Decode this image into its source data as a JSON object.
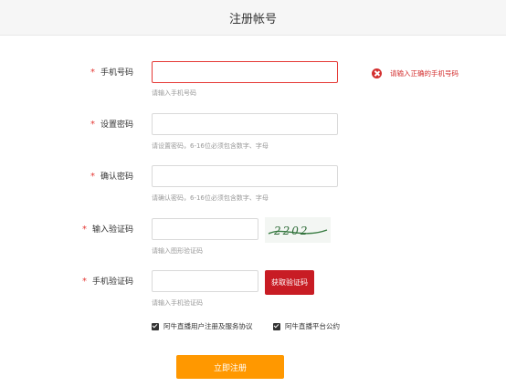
{
  "header": {
    "title": "注册帐号"
  },
  "form": {
    "required_mark": "*",
    "phone": {
      "label": "手机号码",
      "value": "",
      "hint": "请输入手机号码",
      "error": "请输入正确的手机号码"
    },
    "password": {
      "label": "设置密码",
      "value": "",
      "hint": "请设置密码，6-16位必须包含数字、字母"
    },
    "confirm": {
      "label": "确认密码",
      "value": "",
      "hint": "请确认密码，6-16位必须包含数字、字母"
    },
    "captcha": {
      "label": "输入验证码",
      "value": "",
      "hint": "请输入图形验证码",
      "image_text": "2202"
    },
    "sms": {
      "label": "手机验证码",
      "value": "",
      "hint": "请输入手机验证码",
      "button": "获取验证码"
    },
    "agreements": [
      {
        "label": "阿牛直播用户注册及服务协议",
        "checked": true
      },
      {
        "label": "阿牛直播平台公约",
        "checked": true
      }
    ],
    "submit": "立即注册"
  },
  "colors": {
    "accent": "#ff9800",
    "error": "#d32f2f",
    "sms_button": "#c81c24"
  },
  "icons": {
    "error": "error-x-circle-icon",
    "checkbox": "checkbox-checked-icon"
  }
}
